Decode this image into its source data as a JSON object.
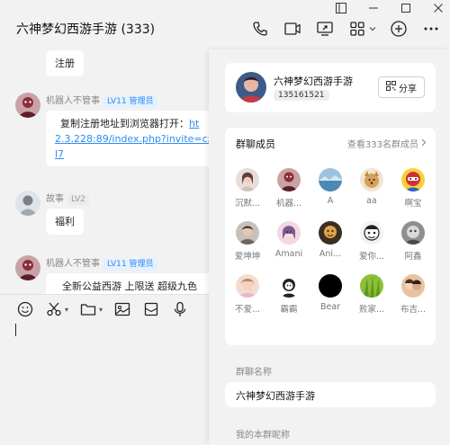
{
  "header": {
    "title": "六神梦幻西游手游 (333)"
  },
  "chat": {
    "messages": [
      {
        "sender": "",
        "badge": "",
        "text": "注册"
      },
      {
        "sender": "机器人不管事",
        "badge": "LV11 管理员",
        "text_prefix": "复制注册地址到浏览器打开：",
        "link_1": "ht",
        "link_2": "2.3.228:89/index.php?invite=cz",
        "link_3": "l7"
      },
      {
        "sender": "故事",
        "badge": "LV2",
        "text": "福利"
      },
      {
        "sender": "机器人不管事",
        "badge": "LV11 管理员",
        "text": "全新公益西游 上限送 超级九色"
      }
    ]
  },
  "panel": {
    "group_name": "六神梦幻西游手游",
    "group_id": "135161521",
    "share_label": "分享",
    "members_title": "群聊成员",
    "members_all": "查看333名群成员",
    "members": [
      {
        "name": "沉默..."
      },
      {
        "name": "机器..."
      },
      {
        "name": "A"
      },
      {
        "name": "aa"
      },
      {
        "name": "啊宝"
      },
      {
        "name": "爱坤坤"
      },
      {
        "name": "Amani"
      },
      {
        "name": "Ani..."
      },
      {
        "name": "爱你..."
      },
      {
        "name": "阿鑫"
      },
      {
        "name": "不爱..."
      },
      {
        "name": "霸霸"
      },
      {
        "name": "Bear"
      },
      {
        "name": "败家..."
      },
      {
        "name": "布吉..."
      }
    ],
    "group_name_label": "群聊名称",
    "group_name_value": "六神梦幻西游手游",
    "my_nickname_label": "我的本群昵称"
  },
  "icons": {
    "window": [
      "sidebar-toggle-icon",
      "minimize-icon",
      "maximize-icon",
      "close-icon"
    ],
    "toolbar": [
      "phone-icon",
      "video-icon",
      "screen-share-icon",
      "apps-icon",
      "chevron-down-icon",
      "add-icon",
      "more-icon"
    ],
    "input": [
      "emoji-icon",
      "scissors-icon",
      "folder-icon",
      "image-icon",
      "mail-icon",
      "microphone-icon"
    ]
  },
  "colors": {
    "accent": "#2d8cf0",
    "badge_blue_bg": "#e4f1ff"
  }
}
